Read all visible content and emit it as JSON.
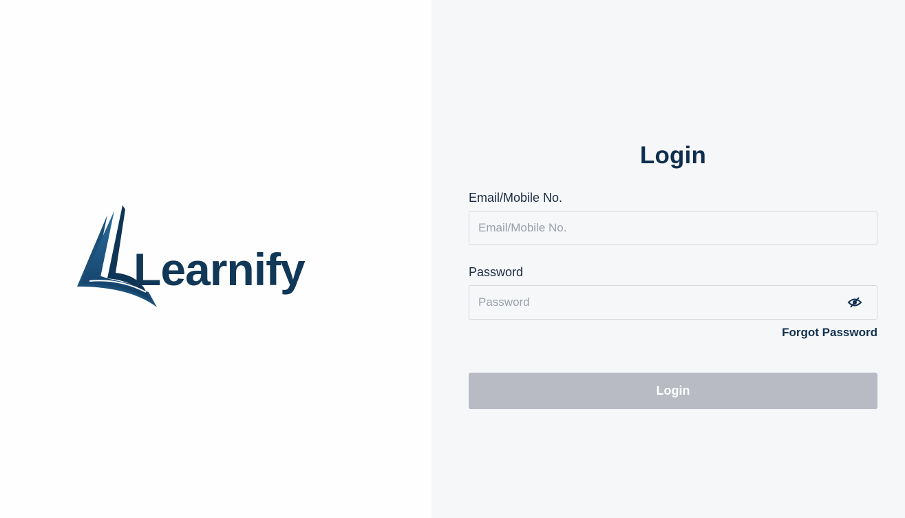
{
  "brand": {
    "name": "Learnify",
    "logo_icon": "open-book-L-logo",
    "colors": {
      "navy": "#0f2f4f",
      "blue": "#1f5f8e"
    }
  },
  "login_form": {
    "title": "Login",
    "email": {
      "label": "Email/Mobile No.",
      "placeholder": "Email/Mobile No.",
      "value": ""
    },
    "password": {
      "label": "Password",
      "placeholder": "Password",
      "value": "",
      "toggle_icon": "eye-slash-icon"
    },
    "forgot_password_label": "Forgot Password",
    "submit_label": "Login",
    "submit_color": "#b8bbc4"
  }
}
